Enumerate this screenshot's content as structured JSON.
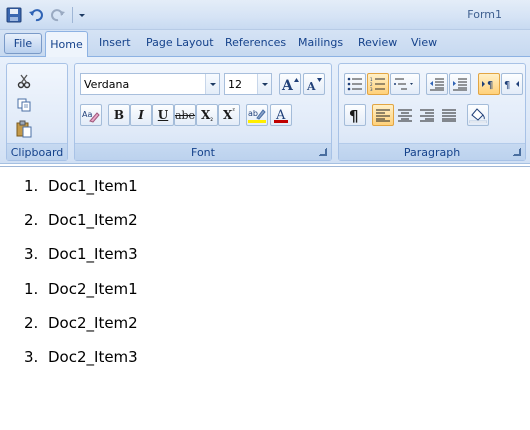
{
  "window": {
    "title": "Form1"
  },
  "quick_access": {
    "icons": [
      "save-icon",
      "undo-icon",
      "redo-icon",
      "customize-dropdown-icon"
    ]
  },
  "tabs": {
    "file": "File",
    "home": "Home",
    "insert": "Insert",
    "page_layout": "Page Layout",
    "references": "References",
    "mailings": "Mailings",
    "review": "Review",
    "view": "View"
  },
  "ribbon": {
    "clipboard": {
      "label": "Clipboard",
      "icons": [
        "cut-icon",
        "copy-icon",
        "paste-icon"
      ]
    },
    "font": {
      "label": "Font",
      "font_name": "Verdana",
      "font_size": "12",
      "format_glyphs": {
        "bold": "B",
        "italic": "I",
        "underline": "U",
        "strike": "abe",
        "subscript": "X",
        "superscript": "X"
      }
    },
    "paragraph": {
      "label": "Paragraph"
    }
  },
  "document": {
    "items": [
      {
        "num": "1.",
        "text": "Doc1_Item1"
      },
      {
        "num": "2.",
        "text": "Doc1_Item2"
      },
      {
        "num": "3.",
        "text": "Doc1_Item3"
      },
      {
        "num": "1.",
        "text": "Doc2_Item1"
      },
      {
        "num": "2.",
        "text": "Doc2_Item2"
      },
      {
        "num": "3.",
        "text": "Doc2_Item3"
      }
    ]
  }
}
